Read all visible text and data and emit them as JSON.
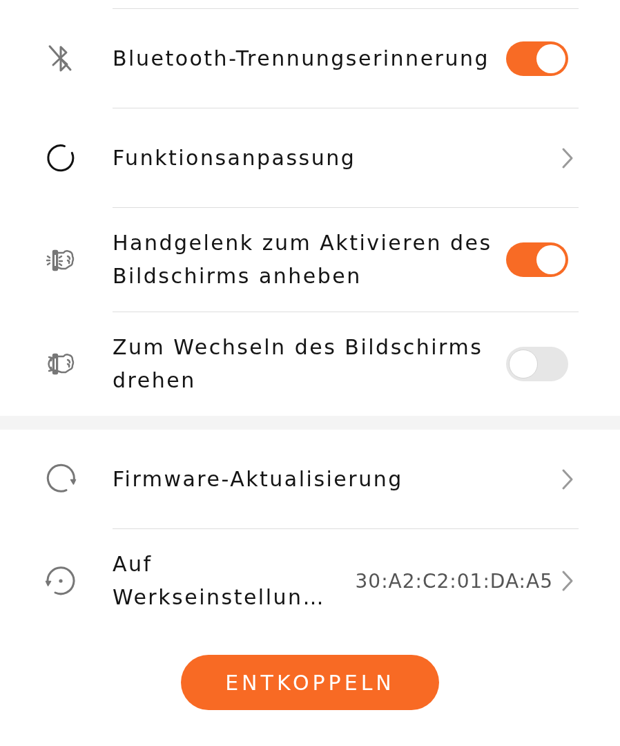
{
  "sections": [
    {
      "items": [
        {
          "kind": "toggle",
          "label": "Bluetooth-Trennungserinnerung",
          "on": true
        },
        {
          "kind": "link",
          "label": "Funktionsanpassung"
        },
        {
          "kind": "toggle",
          "label": "Handgelenk zum Aktivieren des Bildschirms anheben",
          "on": true
        },
        {
          "kind": "toggle",
          "label": "Zum Wechseln des Bildschirms drehen",
          "on": false
        }
      ]
    },
    {
      "items": [
        {
          "kind": "link",
          "label": "Firmware-Aktualisierung"
        },
        {
          "kind": "link",
          "label": "Auf Werkseinstellun…",
          "value": "30:A2:C2:01:DA:A5"
        }
      ]
    }
  ],
  "unpair_button": {
    "label": "ENTKOPPELN"
  }
}
